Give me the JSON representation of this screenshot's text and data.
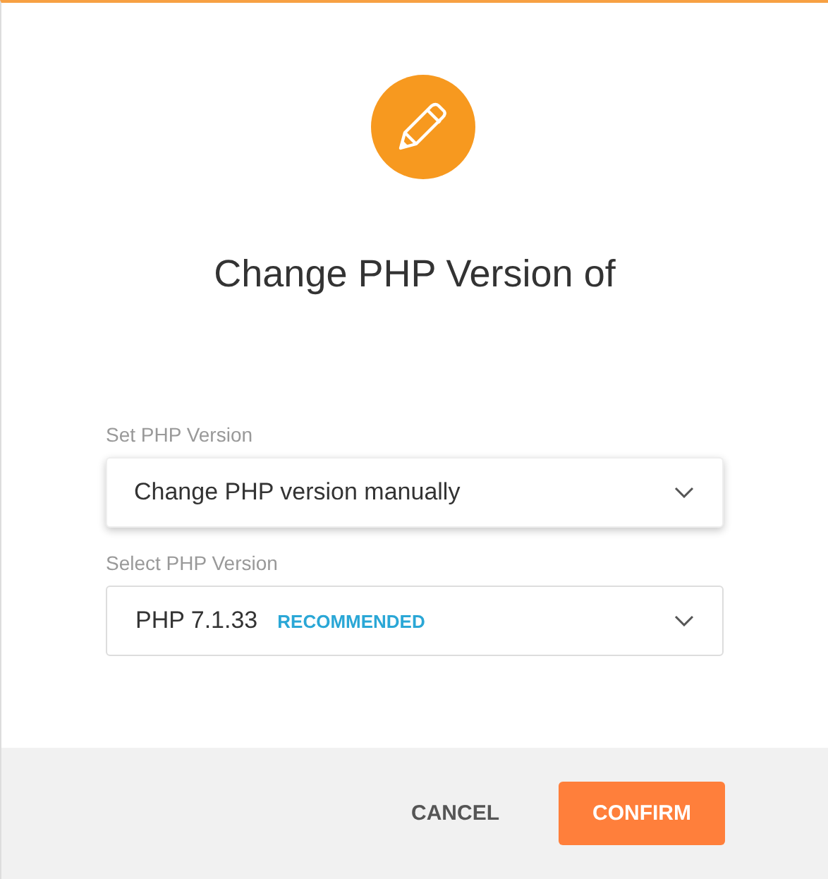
{
  "dialog": {
    "title": "Change PHP Version of"
  },
  "fields": [
    {
      "label": "Set PHP Version",
      "value": "Change PHP version manually",
      "focused": true
    },
    {
      "label": "Select PHP Version",
      "value": "PHP 7.1.33",
      "badge": "RECOMMENDED",
      "focused": false
    }
  ],
  "buttons": [
    {
      "label": "CANCEL",
      "kind": "text"
    },
    {
      "label": "CONFIRM",
      "kind": "primary"
    }
  ]
}
